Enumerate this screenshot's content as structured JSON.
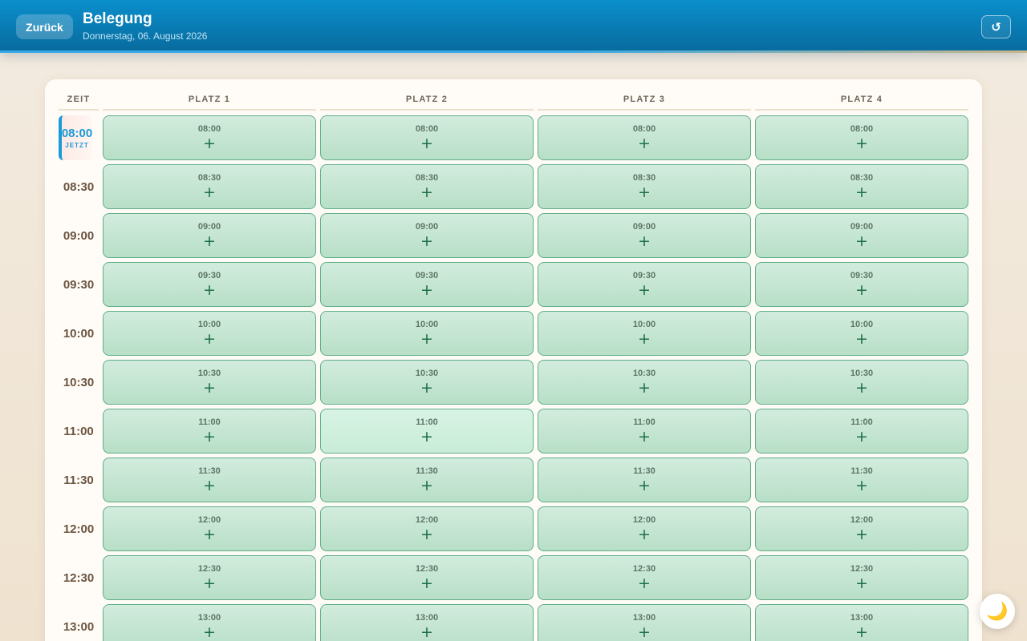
{
  "header": {
    "back_label": "Zurück",
    "title": "Belegung",
    "date": "Donnerstag, 06. August 2026",
    "refresh_icon": "↺"
  },
  "table": {
    "time_header": "ZEIT",
    "courts": [
      "PLATZ 1",
      "PLATZ 2",
      "PLATZ 3",
      "PLATZ 4"
    ],
    "now_time": "08:00",
    "now_label": "JETZT",
    "times": [
      "08:00",
      "08:30",
      "09:00",
      "09:30",
      "10:00",
      "10:30",
      "11:00",
      "11:30",
      "12:00",
      "12:30",
      "13:00"
    ],
    "add_symbol": "+",
    "slot_status": "free"
  },
  "theme_toggle": {
    "icon": "🌙",
    "icon_name": "moon-icon"
  },
  "colors": {
    "header": "#0b8fcc",
    "accent": "#1a9ad8",
    "slot_free": "#c4e6d1",
    "slot_border": "#5fae86"
  }
}
